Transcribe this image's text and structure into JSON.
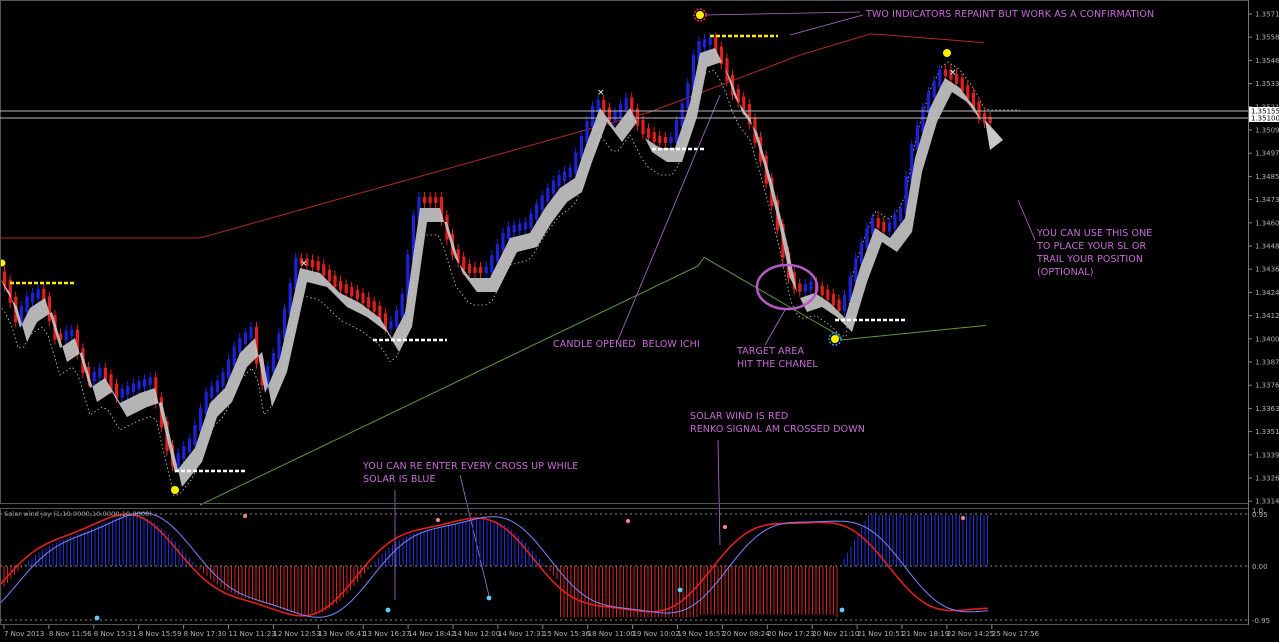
{
  "sub_window": {
    "label": "Solar wind joy (1,10.0000,10.0000,10.0000)",
    "ticks": [
      "1.0",
      "0.95",
      "0.00",
      "-0.95"
    ]
  },
  "price_axis": {
    "ticks": [
      "1.35710",
      "1.35580",
      "1.35460",
      "1.35330",
      "1.35210",
      "1.35095",
      "1.34970",
      "1.34850",
      "1.34730",
      "1.34605",
      "1.34485",
      "1.34365",
      "1.34240",
      "1.34120",
      "1.34000",
      "1.33875",
      "1.33760",
      "1.33635",
      "1.33510",
      "1.33390",
      "1.33260",
      "1.33140"
    ],
    "current_price_labels": [
      "1.35155",
      "1.35100"
    ]
  },
  "time_axis": {
    "ticks": [
      "7 Nov 2013",
      "8 Nov 11:56",
      "8 Nov 15:31",
      "8 Nov 15:59",
      "8 Nov 17:30",
      "11 Nov 11:23",
      "12 Nov 12:53",
      "13 Nov 06:41",
      "13 Nov 16:37",
      "14 Nov 18:42",
      "14 Nov 12:00",
      "14 Nov 17:31",
      "15 Nov 15:36",
      "18 Nov 11:00",
      "19 Nov 10:02",
      "19 Nov 16:57",
      "20 Nov 08:24",
      "20 Nov 17:23",
      "20 Nov 21:10",
      "21 Nov 10:51",
      "21 Nov 18:19",
      "22 Nov 14:25",
      "25 Nov 17:56"
    ]
  },
  "annotations": {
    "repaint": "TWO INDICATORS REPAINT BUT WORK AS A CONFIRMATION",
    "sl": "YOU CAN USE THIS ONE\nTO PLACE YOUR SL OR\nTRAIL YOUR POSITION\n(OPTIONAL)",
    "candle": "CANDLE OPENED  BELOW ICHI",
    "target": "TARGET AREA\nHIT THE CHANEL",
    "solar_red": "SOLAR WIND IS RED\nRENKO SIGNAL AM CROSSED DOWN",
    "reenter": "YOU CAN RE ENTER EVERY CROSS UP WHILE\nSOLAR IS BLUE"
  },
  "colors": {
    "background": "#000000",
    "bull": "#1d22d8",
    "bear": "#e0201c",
    "renko": "#c8c8c8",
    "channel_upper": "#b02a20",
    "channel_lower": "#5c9a3c",
    "annotation": "#c86ad6",
    "level": "#ffffff",
    "level_yellow": "#ffee00"
  }
}
